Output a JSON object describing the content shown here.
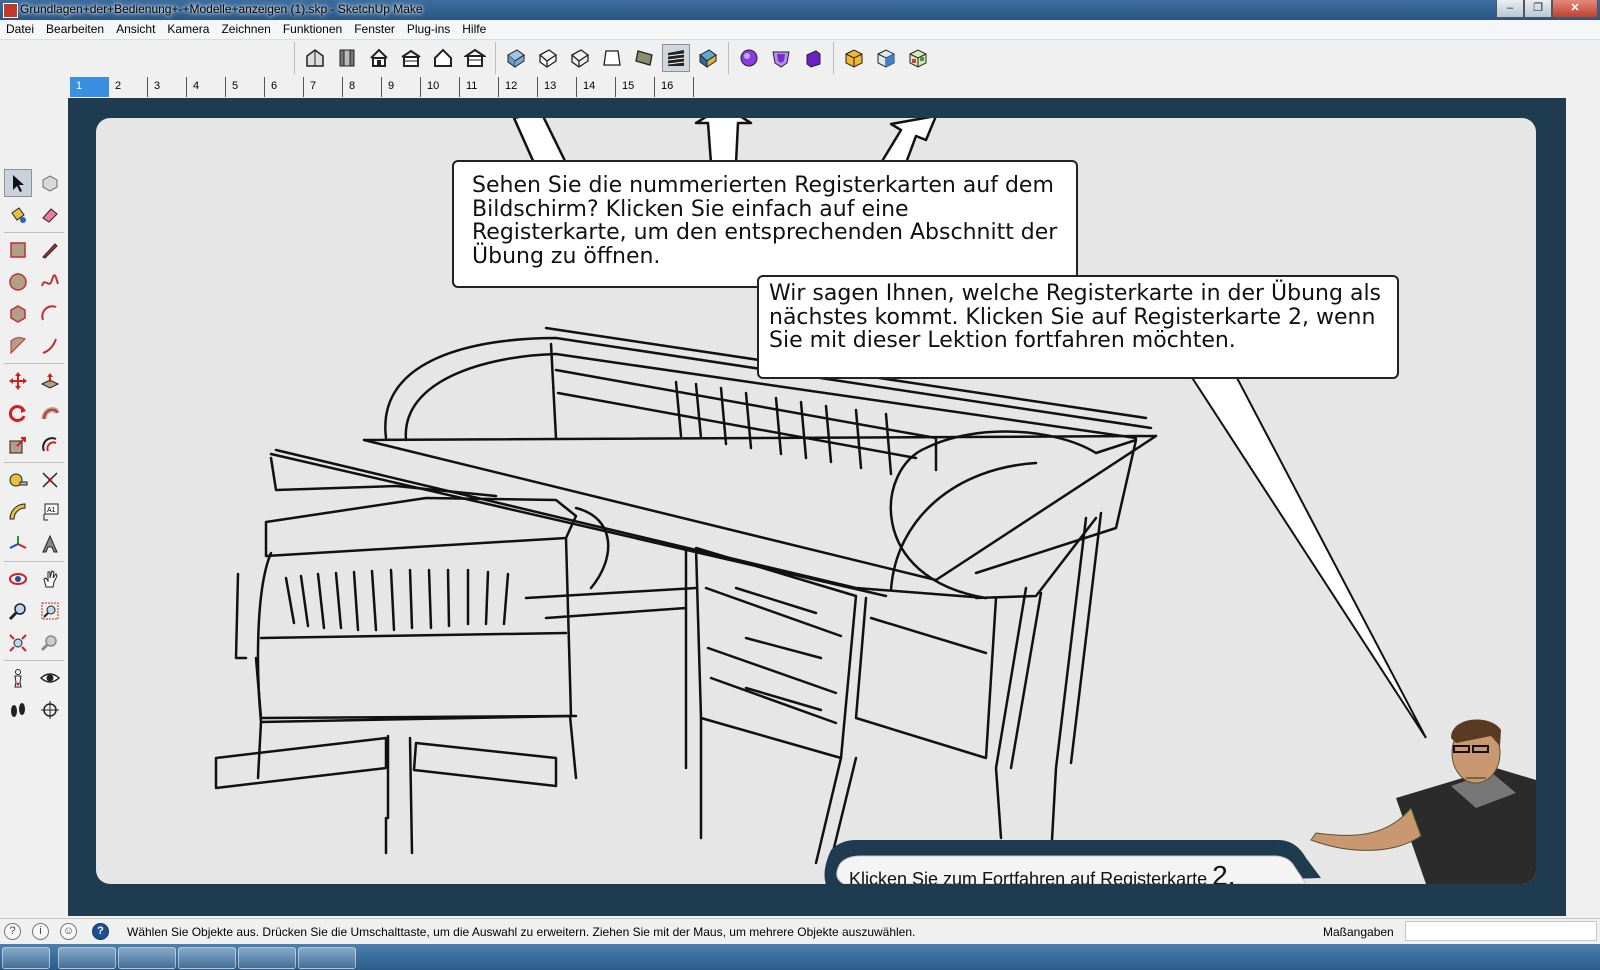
{
  "window": {
    "title": "Grundlagen+der+Bedienung+-+Modelle+anzeigen (1).skp - SketchUp Make",
    "controls": {
      "minimize": "–",
      "restore": "❐",
      "close": "✕"
    }
  },
  "menu": [
    "Datei",
    "Bearbeiten",
    "Ansicht",
    "Kamera",
    "Zeichnen",
    "Funktionen",
    "Fenster",
    "Plug-ins",
    "Hilfe"
  ],
  "toolbar": {
    "groups": [
      [
        "iso-view-icon",
        "top-view-icon",
        "front-view-icon",
        "right-view-icon",
        "back-view-icon",
        "left-view-icon"
      ],
      [
        "xray-icon",
        "back-edges-icon",
        "wireframe-icon",
        "hidden-line-icon",
        "shaded-icon",
        "shaded-textures-icon",
        "monochrome-icon"
      ],
      [
        "union-icon",
        "intersect-icon",
        "subtract-icon"
      ],
      [
        "warehouse-icon",
        "share-model-icon",
        "components-icon"
      ]
    ],
    "active": "shaded-textures-icon"
  },
  "scene_tabs": [
    "1",
    "2",
    "3",
    "4",
    "5",
    "6",
    "7",
    "8",
    "9",
    "10",
    "11",
    "12",
    "13",
    "14",
    "15",
    "16"
  ],
  "active_tab": "1",
  "left_tools": [
    [
      "select-icon",
      "make-component-icon"
    ],
    [
      "paint-bucket-icon",
      "eraser-icon"
    ],
    [
      "rectangle-icon",
      "pencil-icon"
    ],
    [
      "circle-icon",
      "freehand-icon"
    ],
    [
      "polygon-icon",
      "arc-icon"
    ],
    [
      "pie-icon",
      "arc-3pt-icon"
    ],
    [
      "move-icon",
      "push-pull-icon"
    ],
    [
      "rotate-icon",
      "follow-me-icon"
    ],
    [
      "scale-icon",
      "offset-icon"
    ],
    [
      "tape-measure-icon",
      "dimension-icon"
    ],
    [
      "protractor-icon",
      "text-icon"
    ],
    [
      "axes-icon",
      "3d-text-icon"
    ],
    [
      "orbit-icon",
      "pan-icon"
    ],
    [
      "zoom-icon",
      "zoom-window-icon"
    ],
    [
      "zoom-extents-icon",
      "previous-view-icon"
    ],
    [
      "position-camera-icon",
      "look-around-icon"
    ],
    [
      "walk-icon",
      "section-plane-icon"
    ]
  ],
  "tutorial": {
    "bubble1": "Sehen Sie die nummerierten Registerkarten auf dem Bildschirm? Klicken Sie einfach auf eine Registerkarte, um den entsprechenden Abschnitt der Übung zu öffnen.",
    "bubble2": "Wir sagen Ihnen, welche Registerkarte in der Übung als nächstes kommt. Klicken Sie auf Registerkarte 2, wenn Sie mit dieser Lektion fortfahren möchten.",
    "footer_text": "Klicken Sie zum Fortfahren auf Registerkarte",
    "footer_number": "2."
  },
  "status": {
    "text": "Wählen Sie Objekte aus. Drücken Sie die Umschalttaste, um die Auswahl zu erweitern. Ziehen Sie mit der Maus, um mehrere Objekte auszuwählen.",
    "measure_label": "Maßangaben",
    "measure_value": ""
  },
  "colors": {
    "viewport_bg": "#1e3b4f",
    "board_bg": "#e6e6e6",
    "tab_active": "#3b8fe0"
  }
}
